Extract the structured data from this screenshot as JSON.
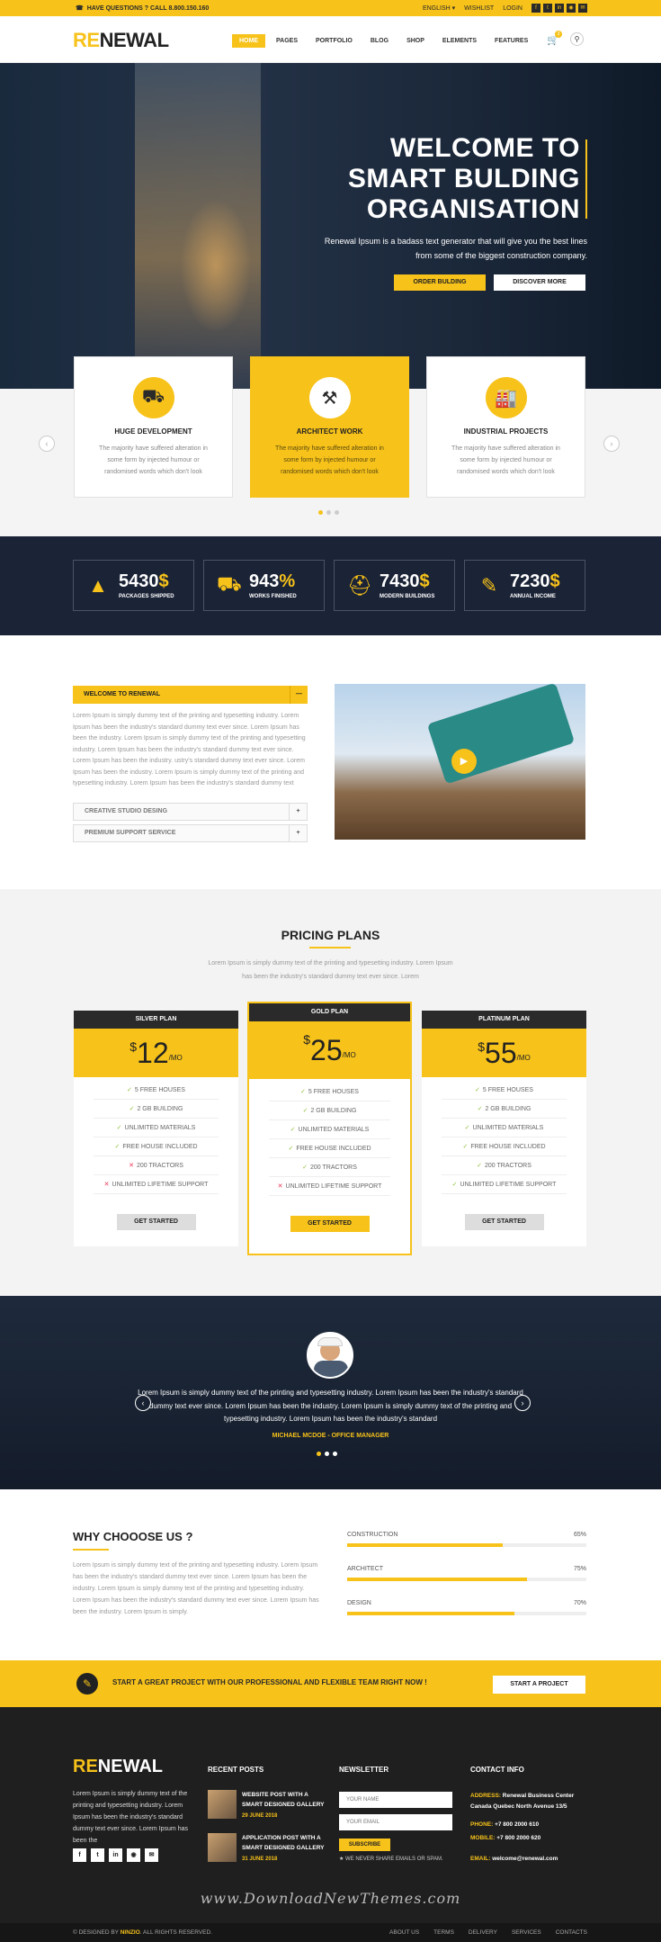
{
  "topbar": {
    "phone_text": "HAVE QUESTIONS ? CALL 8.800.150.160",
    "language": "ENGLISH",
    "wishlist": "WISHLIST",
    "login": "LOGIN",
    "social_icons": [
      "facebook-icon",
      "twitter-icon",
      "linkedin-icon",
      "instagram-icon",
      "email-icon"
    ]
  },
  "header": {
    "logo_re": "RE",
    "logo_rest": "NEWAL",
    "nav": [
      "HOME",
      "PAGES",
      "PORTFOLIO",
      "BLOG",
      "SHOP",
      "ELEMENTS",
      "FEATURES"
    ],
    "cart_count": "3",
    "accent": "#f7c21a"
  },
  "hero": {
    "title_1": "WELCOME TO",
    "title_2": "SMART BULDING",
    "title_3": "ORGANISATION",
    "text": "Renewal Ipsum is a badass text generator that will give you the best lines from some of the biggest construction company.",
    "btn_primary": "ORDER BULDING",
    "btn_secondary": "DISCOVER MORE"
  },
  "features": [
    {
      "icon": "truck-icon",
      "title": "HUGE DEVELOPMENT",
      "text": "The majority have suffered alteration in some form by injected humour or randomised words which don't look"
    },
    {
      "icon": "tools-icon",
      "title": "ARCHITECT WORK",
      "text": "The majority have suffered alteration in some form by injected humour or randomised words which don't look"
    },
    {
      "icon": "factory-icon",
      "title": "INDUSTRIAL PROJECTS",
      "text": "The majority have suffered alteration in some form by injected humour or randomised words which don't look"
    }
  ],
  "stats": [
    {
      "icon": "cone-icon",
      "number": "5430",
      "suffix": "$",
      "label": "PACKAGES SHIPPED"
    },
    {
      "icon": "excavator-icon",
      "number": "943",
      "suffix": "%",
      "label": "WORKS FINISHED"
    },
    {
      "icon": "helmet-icon",
      "number": "7430",
      "suffix": "$",
      "label": "MODERN BUILDINGS"
    },
    {
      "icon": "brush-icon",
      "number": "7230",
      "suffix": "$",
      "label": "ANNUAL INCOME"
    }
  ],
  "about": {
    "accordion_title": "WELCOME TO RENEWAL",
    "accordion_text": "Lorem Ipsum is simply dummy text of the printing and typesetting industry. Lorem Ipsum has been the industry's standard dummy text ever since. Lorem Ipsum has been the industry. Lorem Ipsum is simply dummy text of the printing and typesetting industry. Lorem Ipsum has been the industry's standard dummy text ever since. Lorem Ipsum has been the industry. ustry's standard dummy text ever since. Lorem Ipsum has been the industry. Lorem Ipsum is simply dummy text of the printing and typesetting industry. Lorem Ipsum has been the industry's standard dummy text",
    "item_1": "CREATIVE STUDIO DESING",
    "item_2": "PREMIUM SUPPORT SERVICE"
  },
  "pricing": {
    "title": "PRICING PLANS",
    "subtitle": "Lorem Ipsum is simply dummy text of the printing and typesetting industry. Lorem Ipsum has been the industry's standard dummy text ever since. Lorem",
    "plans": [
      {
        "name": "SILVER PLAN",
        "currency": "$",
        "amount": "12",
        "per": "/MO",
        "features": [
          [
            "check",
            "5 FREE HOUSES"
          ],
          [
            "check",
            "2 GB BUILDING"
          ],
          [
            "check",
            "UNLIMITED  MATERIALS"
          ],
          [
            "check",
            "FREE HOUSE INCLUDED"
          ],
          [
            "cross",
            "200 TRACTORS"
          ],
          [
            "cross",
            "UNLIMITED LIFETIME SUPPORT"
          ]
        ],
        "button": "GET STARTED"
      },
      {
        "name": "GOLD PLAN",
        "currency": "$",
        "amount": "25",
        "per": "/MO",
        "features": [
          [
            "check",
            "5 FREE HOUSES"
          ],
          [
            "check",
            "2 GB BUILDING"
          ],
          [
            "check",
            "UNLIMITED  MATERIALS"
          ],
          [
            "check",
            "FREE HOUSE INCLUDED"
          ],
          [
            "check",
            "200 TRACTORS"
          ],
          [
            "cross",
            "UNLIMITED LIFETIME SUPPORT"
          ]
        ],
        "button": "GET STARTED"
      },
      {
        "name": "PLATINUM PLAN",
        "currency": "$",
        "amount": "55",
        "per": "/MO",
        "features": [
          [
            "check",
            "5 FREE HOUSES"
          ],
          [
            "check",
            "2 GB BUILDING"
          ],
          [
            "check",
            "UNLIMITED  MATERIALS"
          ],
          [
            "check",
            "FREE HOUSE INCLUDED"
          ],
          [
            "check",
            "200 TRACTORS"
          ],
          [
            "check",
            "UNLIMITED LIFETIME SUPPORT"
          ]
        ],
        "button": "GET STARTED"
      }
    ]
  },
  "testimonial": {
    "text": "Lorem Ipsum is simply dummy text of the printing and typesetting industry. Lorem Ipsum has been the industry's standard dummy text ever since. Lorem Ipsum has been the industry. Lorem Ipsum is simply dummy text of the printing and typesetting industry. Lorem Ipsum has been the industry's standard",
    "author": "MICHAEL MCDOE - OFFICE MANAGER"
  },
  "why": {
    "title": "WHY CHOOOSE US ?",
    "text": "Lorem Ipsum is simply dummy text of the printing and typesetting industry. Lorem Ipsum has been the industry's standard dummy text ever since. Lorem Ipsum has been the industry. Lorem Ipsum is simply dummy text of the printing and typesetting industry. Lorem Ipsum has been the industry's standard dummy text ever since. Lorem Ipsum has been the industry. Lorem Ipsum is simply.",
    "skills": [
      {
        "label": "CONSTRUCTION",
        "percent": "65%",
        "value": 65
      },
      {
        "label": "ARCHITECT",
        "percent": "75%",
        "value": 75
      },
      {
        "label": "DESIGN",
        "percent": "70%",
        "value": 70
      }
    ]
  },
  "cta": {
    "text": "START A GREAT PROJECT WITH OUR PROFESSIONAL AND FLEXIBLE TEAM RIGHT NOW !",
    "button": "START A PROJECT"
  },
  "footer": {
    "logo_re": "RE",
    "logo_rest": "NEWAL",
    "desc": "Lorem Ipsum is simply dummy text of the printing and typesetting industry. Lorem Ipsum has been the industry's standard dummy text ever since. Lorem Ipsum has been the",
    "recent_title": "RECENT POSTS",
    "posts": [
      {
        "title": "WEBSITE POST WITH A SMART DESIGNED GALLERY",
        "date": "29 JUNE 2018"
      },
      {
        "title": "APPLICATION POST WITH A SMART DESIGNED GALLERY",
        "date": "31 JUNE 2018"
      }
    ],
    "newsletter_title": "NEWSLETTER",
    "name_placeholder": "YOUR NAME",
    "email_placeholder": "YOUR EMAIL",
    "subscribe": "SUBSCRIBE",
    "note": "★ WE NEVER SHARE EMAILS OR SPAM.",
    "contact_title": "CONTACT INFO",
    "address_label": "ADDRESS:",
    "address_1": "Renewal Business Center",
    "address_2": "Canada Quebec North Avenue 13/5",
    "phone_label": "PHONE:",
    "phone": "+7 800 2000 610",
    "mobile_label": "MOBILE:",
    "mobile": "+7 800 2000 620",
    "email_label": "EMAIL:",
    "email": "welcome@renewal.com"
  },
  "watermark": "www.DownloadNewThemes.com",
  "bottom": {
    "designed": "© DESIGNED BY",
    "brand": "NINZIO",
    "rights": ". ALL RIGHTS RESERVED.",
    "links": [
      "ABOUT US",
      "TERMS",
      "DELIVERY",
      "SERVICES",
      "CONTACTS"
    ]
  }
}
